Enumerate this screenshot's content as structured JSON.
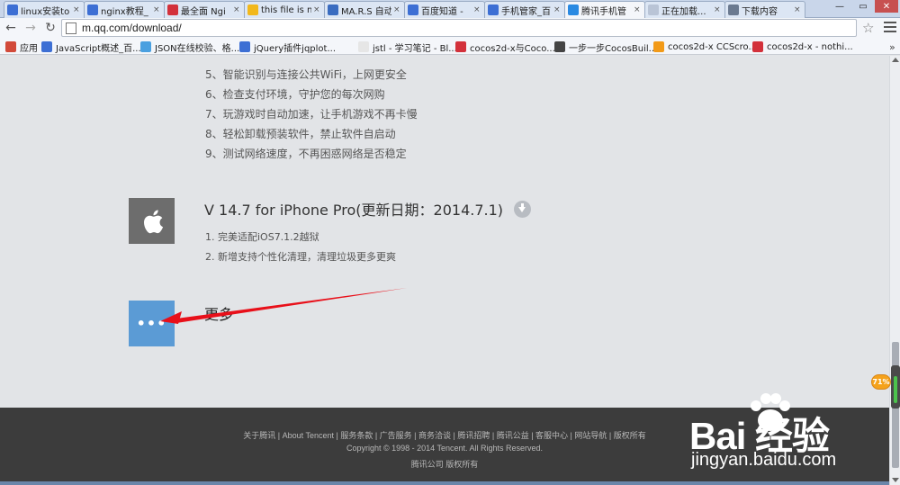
{
  "browser": {
    "tabs": [
      {
        "title": "linux安装to",
        "fav": "#3d6fd4"
      },
      {
        "title": "nginx教程_",
        "fav": "#3d6fd4"
      },
      {
        "title": "最全面 Ngi",
        "fav": "#d3313b"
      },
      {
        "title": "this file is n",
        "fav": "#f2b81c"
      },
      {
        "title": "MA.R.S 自动",
        "fav": "#3a6cc0"
      },
      {
        "title": "百度知道 - ",
        "fav": "#3d6fd4"
      },
      {
        "title": "手机管家_百",
        "fav": "#3d6fd4"
      },
      {
        "title": "腾讯手机管",
        "fav": "#2a8ae2"
      },
      {
        "title": "正在加载...",
        "fav": "#b9c4d6"
      },
      {
        "title": "下载内容",
        "fav": "#6b7a90"
      }
    ],
    "url": "m.qq.com/download/",
    "bookmarks": [
      {
        "label": "应用",
        "fav": "#d24a3a"
      },
      {
        "label": "JavaScript概述_百...",
        "fav": "#3d6fd4"
      },
      {
        "label": "JSON在线校验、格...",
        "fav": "#4aa0e0"
      },
      {
        "label": "jQuery插件jqplot...",
        "fav": "#3d6fd4"
      },
      {
        "label": "jstl - 学习笔记 - Bl...",
        "fav": "#e6e6e6"
      },
      {
        "label": "cocos2d-x与Coco...",
        "fav": "#d3313b"
      },
      {
        "label": "一步一步CocosBuil...",
        "fav": "#444444"
      },
      {
        "label": "cocos2d-x CCScro...",
        "fav": "#f29a18"
      },
      {
        "label": "cocos2d-x - nothi...",
        "fav": "#d3313b"
      }
    ],
    "bookmarks_more": "»"
  },
  "page": {
    "features": [
      "5、智能识别与连接公共WiFi，上网更安全",
      "6、检查支付环境，守护您的每次网购",
      "7、玩游戏时自动加速，让手机游戏不再卡慢",
      "8、轻松卸载预装软件，禁止软件自启动",
      "9、测试网络速度，不再困惑网络是否稳定"
    ],
    "ios_version": "V 14.7 for iPhone Pro(更新日期：2014.7.1)",
    "ios_notes": [
      "1. 完美适配iOS7.1.2越狱",
      "2. 新增支持个性化清理，清理垃圾更多更爽"
    ],
    "more_button": "•••",
    "more_title": "更多"
  },
  "footer": {
    "links": "关于腾讯 | About Tencent | 服务条款 | 广告服务 | 商务洽谈 | 腾讯招聘 | 腾讯公益 | 客服中心 | 网站导航 | 版权所有",
    "copyright": "Copyright © 1998 - 2014 Tencent. All Rights Reserved.",
    "company": "腾讯公司 版权所有"
  },
  "overlay": {
    "speed_badge": "71%",
    "watermark_logo": "Bai  经验",
    "watermark_url": "jingyan.baidu.com"
  }
}
